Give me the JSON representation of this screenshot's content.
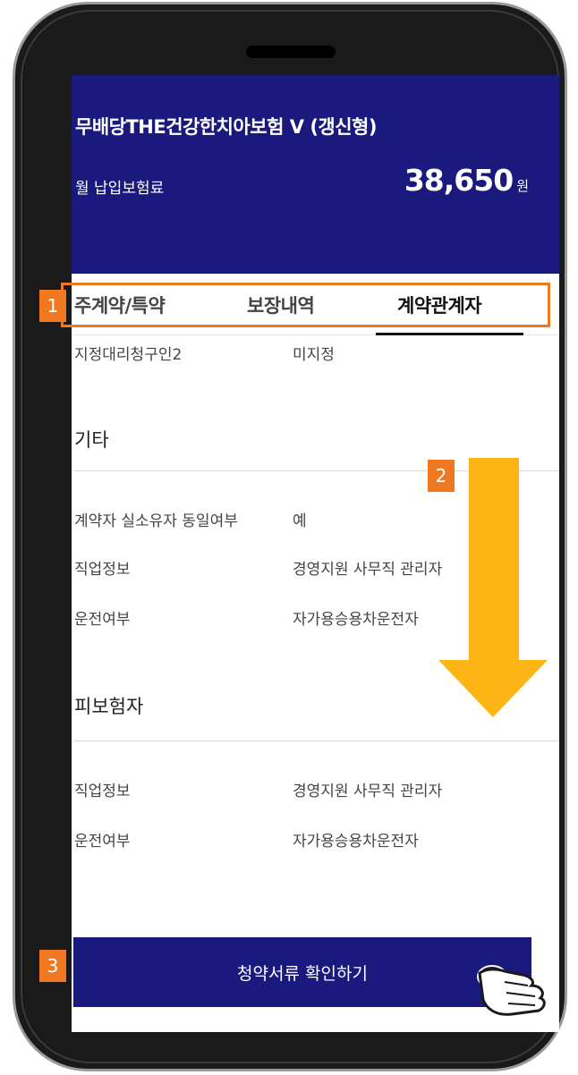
{
  "header": {
    "title": "무배당THE건강한치아보험 V (갱신형)",
    "premium_label": "월 납입보험료",
    "premium_amount": "38,650",
    "premium_unit": "원"
  },
  "tabs": [
    {
      "label": "주계약/특약",
      "active": false
    },
    {
      "label": "보장내역",
      "active": false
    },
    {
      "label": "계약관계자",
      "active": true
    }
  ],
  "top_row": {
    "label": "지정대리청구인2",
    "value": "미지정"
  },
  "sections": [
    {
      "title": "기타",
      "rows": [
        {
          "label": "계약자 실소유자 동일여부",
          "value": "예"
        },
        {
          "label": "직업정보",
          "value": "경영지원 사무직 관리자"
        },
        {
          "label": "운전여부",
          "value": "자가용승용차운전자"
        }
      ]
    },
    {
      "title": "피보험자",
      "rows": [
        {
          "label": "직업정보",
          "value": "경영지원 사무직 관리자"
        },
        {
          "label": "운전여부",
          "value": "자가용승용차운전자"
        }
      ]
    }
  ],
  "cta_label": "청약서류 확인하기",
  "callouts": [
    "1",
    "2",
    "3"
  ],
  "colors": {
    "header_bg": "#1a1a7e",
    "callout": "#f07820",
    "arrow": "#fdb515"
  },
  "icons": {
    "scroll_arrow": "arrow-down-icon",
    "tap_hand": "pointing-hand-icon"
  }
}
